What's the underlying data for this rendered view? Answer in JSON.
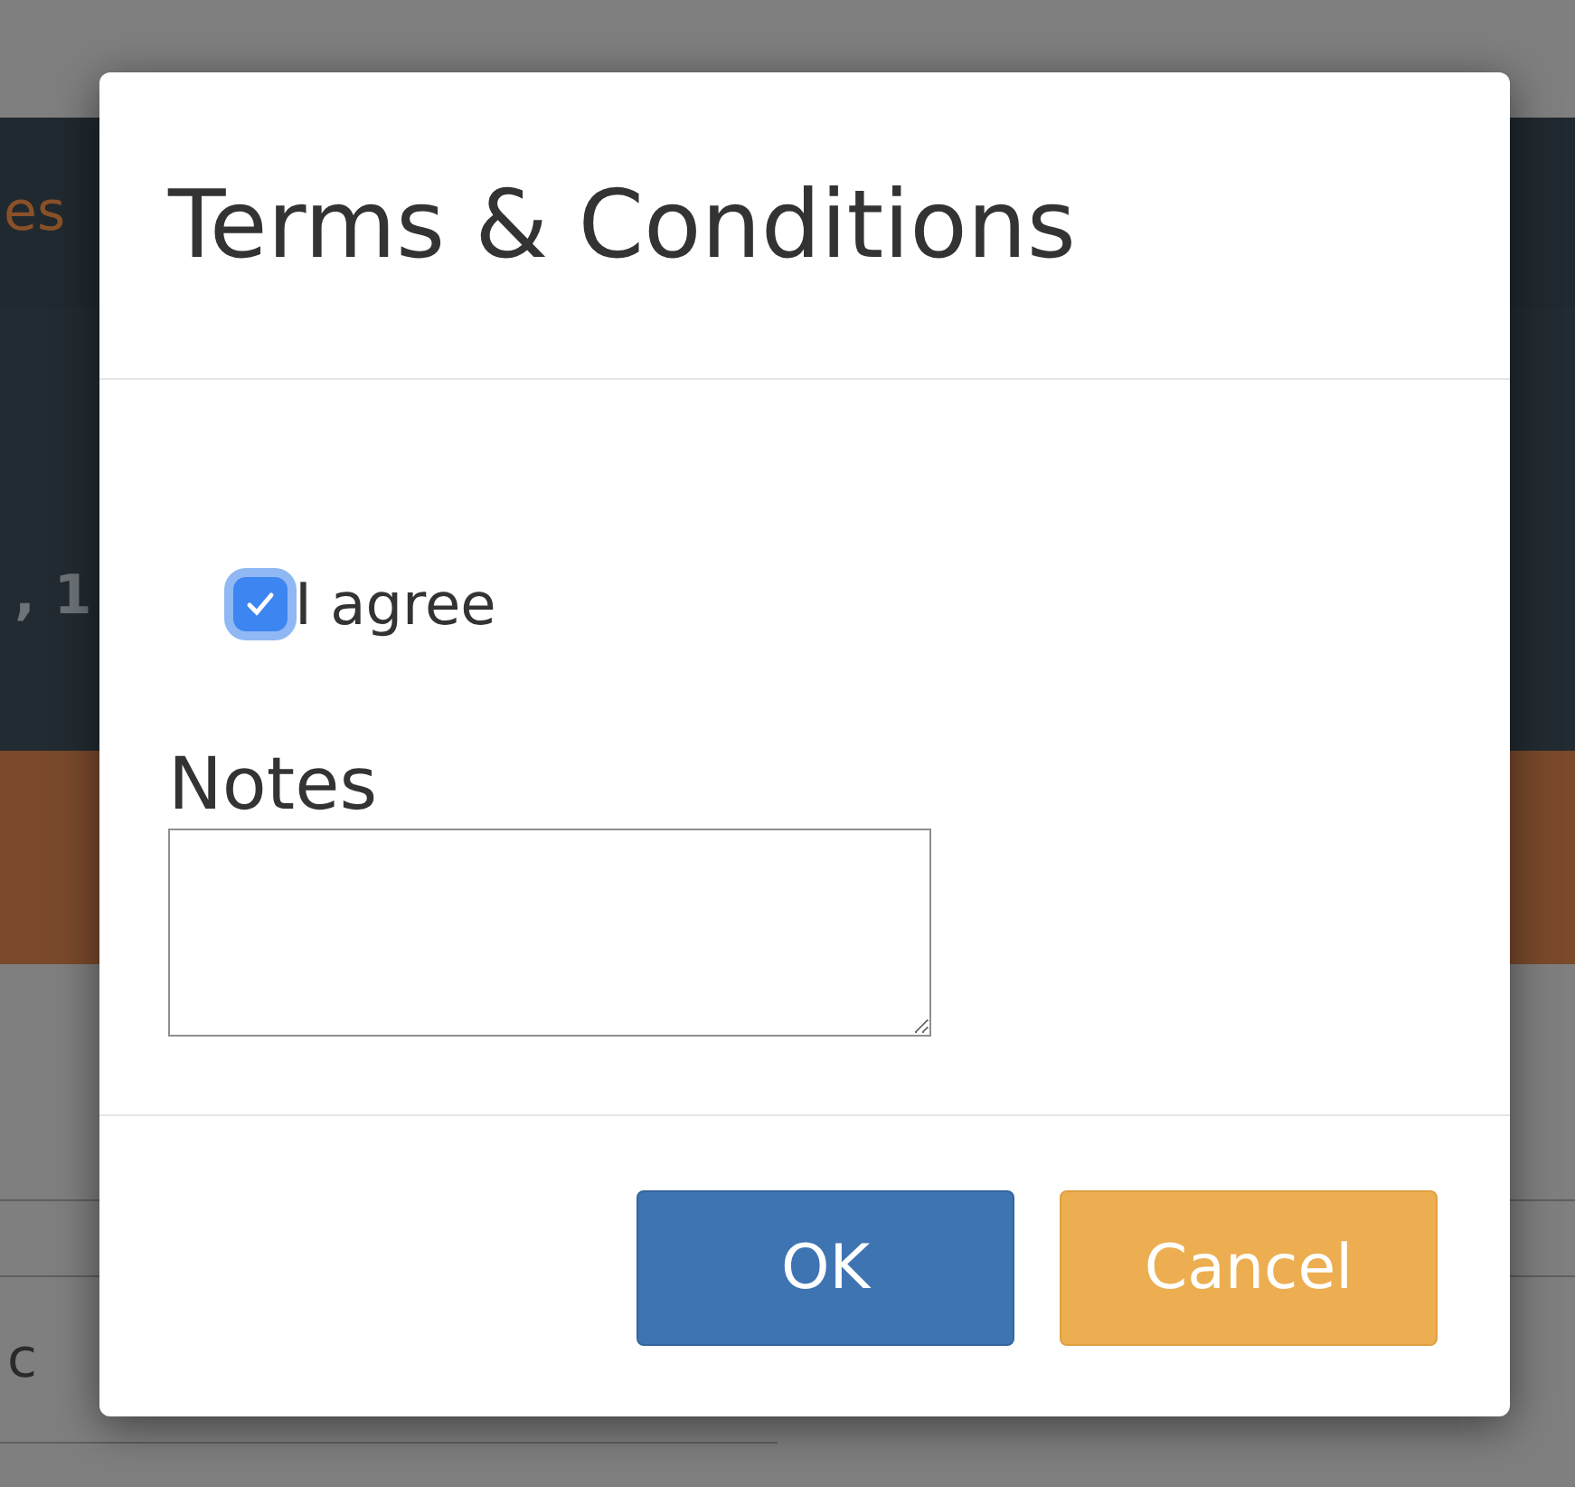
{
  "background": {
    "nav_text": "es",
    "header_text": ", 1",
    "row_text": "c"
  },
  "dialog": {
    "title": "Terms & Conditions",
    "agree": {
      "label": "I agree",
      "checked": true
    },
    "notes": {
      "label": "Notes"
    },
    "buttons": [
      {
        "label": "OK",
        "kind": "primary"
      },
      {
        "label": "Cancel",
        "kind": "warning"
      }
    ]
  }
}
